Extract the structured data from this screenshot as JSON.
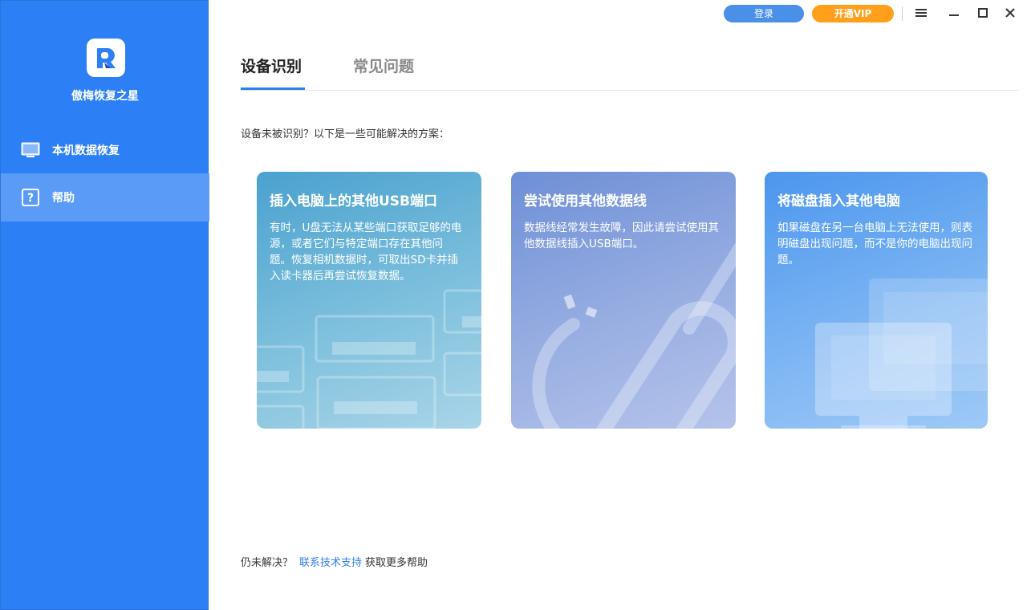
{
  "app": {
    "name": "傲梅恢复之星"
  },
  "topbar": {
    "login_label": "登录",
    "vip_label": "开通VIP"
  },
  "sidebar": {
    "items": [
      {
        "label": "本机数据恢复",
        "icon": "monitor-icon",
        "active": false
      },
      {
        "label": "帮助",
        "icon": "help-icon",
        "active": true
      }
    ]
  },
  "tabs": [
    {
      "label": "设备识别",
      "active": true
    },
    {
      "label": "常见问题",
      "active": false
    }
  ],
  "intro": "设备未被识别？以下是一些可能解决的方案：",
  "cards": [
    {
      "title": "插入电脑上的其他USB端口",
      "body": "有时，U盘无法从某些端口获取足够的电源，或者它们与特定端口存在其他问题。恢复相机数据时，可取出SD卡并插入读卡器后再尝试恢复数据。",
      "illustration": "usb-ports-icon"
    },
    {
      "title": "尝试使用其他数据线",
      "body": "数据线经常发生故障，因此请尝试使用其他数据线插入USB端口。",
      "illustration": "cable-icon"
    },
    {
      "title": "将磁盘插入其他电脑",
      "body": "如果磁盘在另一台电脑上无法使用，则表明磁盘出现问题，而不是你的电脑出现问题。",
      "illustration": "computer-icon"
    }
  ],
  "footer": {
    "prefix": "仍未解决？",
    "link": "联系技术支持",
    "suffix": "获取更多帮助"
  },
  "colors": {
    "accent": "#2d7ff5",
    "vip": "#ff9f1a",
    "sidebar_active": "#5a9bf7"
  }
}
